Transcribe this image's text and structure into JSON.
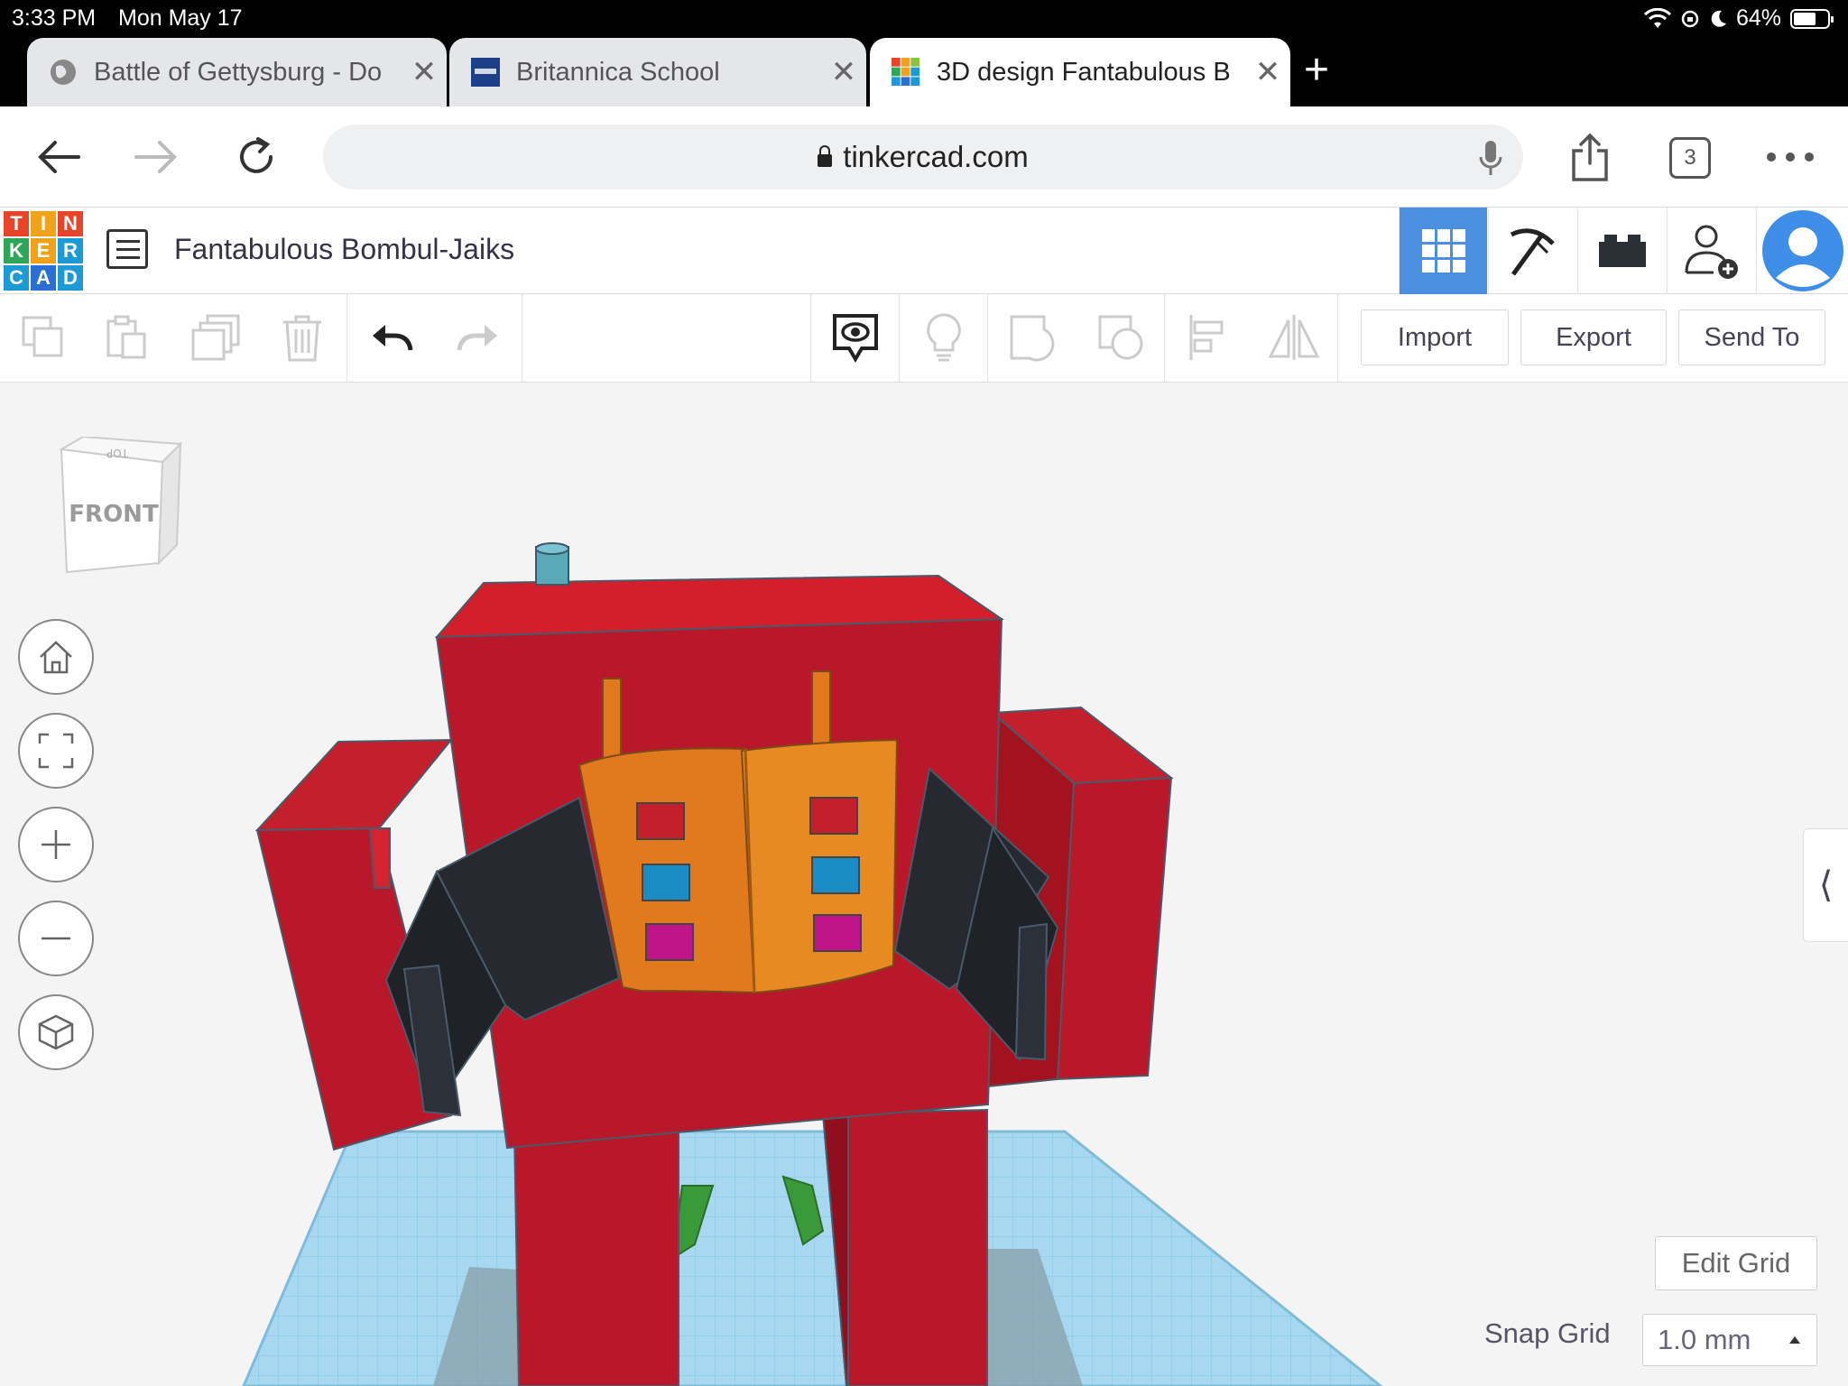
{
  "status_bar": {
    "time": "3:33 PM",
    "date": "Mon May 17",
    "battery": "64%"
  },
  "tabs": [
    {
      "title": "Battle of Gettysburg - Do",
      "icon": "globe-icon",
      "active": false
    },
    {
      "title": "Britannica School",
      "icon": "britannica-icon",
      "active": false
    },
    {
      "title": "3D design Fantabulous B",
      "icon": "tinkercad-icon",
      "active": true
    }
  ],
  "address_bar": {
    "url": "tinkercad.com",
    "tab_count": "3"
  },
  "header": {
    "logo_letters": [
      "T",
      "I",
      "N",
      "K",
      "E",
      "R",
      "C",
      "A",
      "D"
    ],
    "design_title": "Fantabulous Bombul-Jaiks"
  },
  "toolbar": {
    "import_label": "Import",
    "export_label": "Export",
    "send_to_label": "Send To"
  },
  "view_cube": {
    "front_label": "FRONT",
    "top_label": "TOP"
  },
  "footer": {
    "edit_grid_label": "Edit Grid",
    "snap_grid_label": "Snap Grid",
    "snap_grid_value": "1.0 mm"
  },
  "colors": {
    "robot_red": "#cc1e2a",
    "arm_dark": "#262a30",
    "torso_orange": "#e07a1c",
    "grid_blue": "#a8d8ef",
    "accent_blue": "#4a8fe0"
  }
}
